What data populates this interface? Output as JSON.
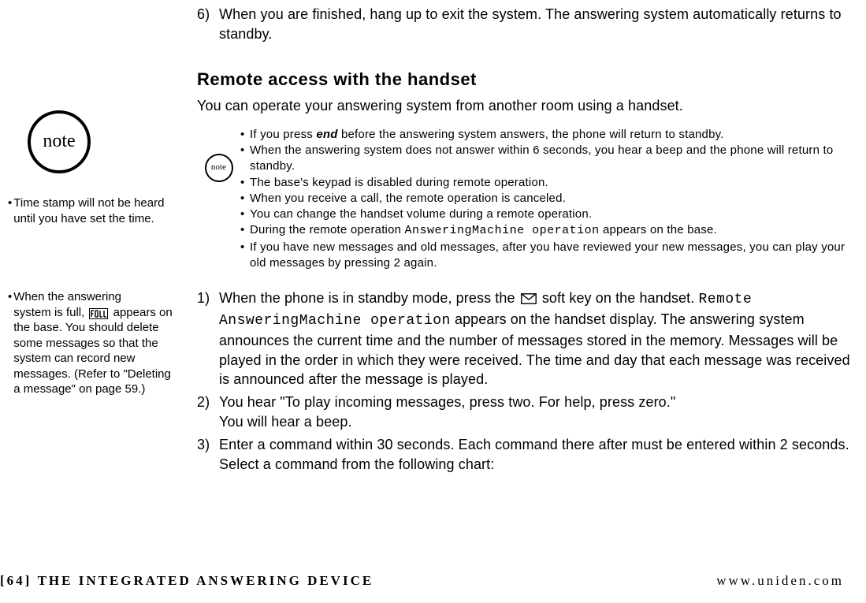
{
  "sidebar": {
    "note_label": "note",
    "bullets": [
      "Time stamp will not be heard until you have set the time.",
      "When the answering system is full, [FULL] appears on the base. You should delete some messages so that the system can record new messages. (Refer to \"Deleting a message\" on page 59.)"
    ],
    "bullet2_pre": "When the answering ",
    "bullet2_line2a": "system is full, ",
    "bullet2_line2b": " appears on the base. You should delete some messages so that the system can record new messages. (Refer to \"Deleting a message\" on page 59.)"
  },
  "main": {
    "step6_num": "6)",
    "step6_text": "When you are finished, hang up to exit the system. The answering system automatically returns to standby.",
    "section_title": "Remote access with the handset",
    "intro": "You can operate your answering system from another room using a handset.",
    "notes": {
      "icon_label": "note",
      "items": [
        {
          "pre": "If you press ",
          "em": "end",
          "post": " before the answering system answers, the phone will return to standby."
        },
        {
          "text": "When the answering system does not answer within 6 seconds, you hear a beep and the phone will return to standby."
        },
        {
          "text": "The base's keypad is disabled during remote operation."
        },
        {
          "text": "When you receive a call, the remote operation is canceled."
        },
        {
          "text": "You can change the handset volume during a remote operation."
        },
        {
          "pre": "During the remote operation ",
          "lcd": "AnsweringMachine operation",
          "post": " appears on the base."
        },
        {
          "text": "If you have new messages and old messages, after you have reviewed your new messages, you can play your old messages by pressing 2 again."
        }
      ]
    },
    "steps": {
      "s1_num": "1)",
      "s1_pre": "When the phone is in standby mode, press the ",
      "s1_mid1": " soft key on the handset. ",
      "s1_lcd": "Remote AnsweringMachine operation",
      "s1_post": " appears on the handset display. The answering system announces the current time and the number of messages stored in the memory. Messages will be played in the order in which they were received. The time and day that each message was received is announced after the message is played.",
      "s2_num": "2)",
      "s2_line1": "You hear \"To play incoming messages, press two. For help, press zero.\"",
      "s2_line2": "You will hear a beep.",
      "s3_num": "3)",
      "s3_text": "Enter a command within 30 seconds. Each command there after must be entered within 2 seconds. Select a command from the following chart:"
    }
  },
  "footer": {
    "page": "[64]",
    "chapter": "THE INTEGRATED ANSWERING DEVICE",
    "url": "www.uniden.com"
  }
}
